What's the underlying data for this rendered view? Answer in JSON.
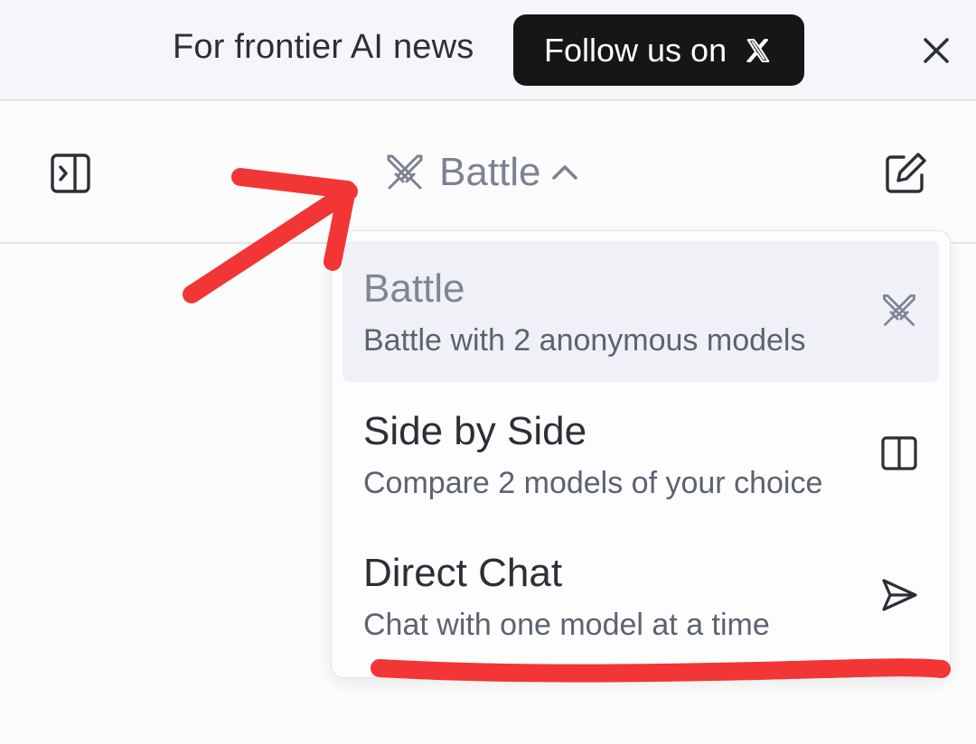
{
  "banner": {
    "text": "For frontier AI news",
    "follow_label": "Follow us on",
    "x_icon": "x-logo-icon",
    "close_icon": "close-icon"
  },
  "header": {
    "sidebar_icon": "sidebar-expand-icon",
    "mode_label": "Battle",
    "mode_icon": "crossed-swords-icon",
    "chevron_icon": "chevron-up-icon",
    "new_chat_icon": "edit-icon"
  },
  "dropdown": {
    "items": [
      {
        "title": "Battle",
        "description": "Battle with 2 anonymous models",
        "icon": "crossed-swords-icon",
        "selected": true
      },
      {
        "title": "Side by Side",
        "description": "Compare 2 models of your choice",
        "icon": "columns-icon",
        "selected": false
      },
      {
        "title": "Direct Chat",
        "description": "Chat with one model at a time",
        "icon": "send-icon",
        "selected": false
      }
    ]
  },
  "colors": {
    "annotation": "#f23535",
    "selected_bg": "#f0f1f6",
    "follow_bg": "#161616"
  }
}
